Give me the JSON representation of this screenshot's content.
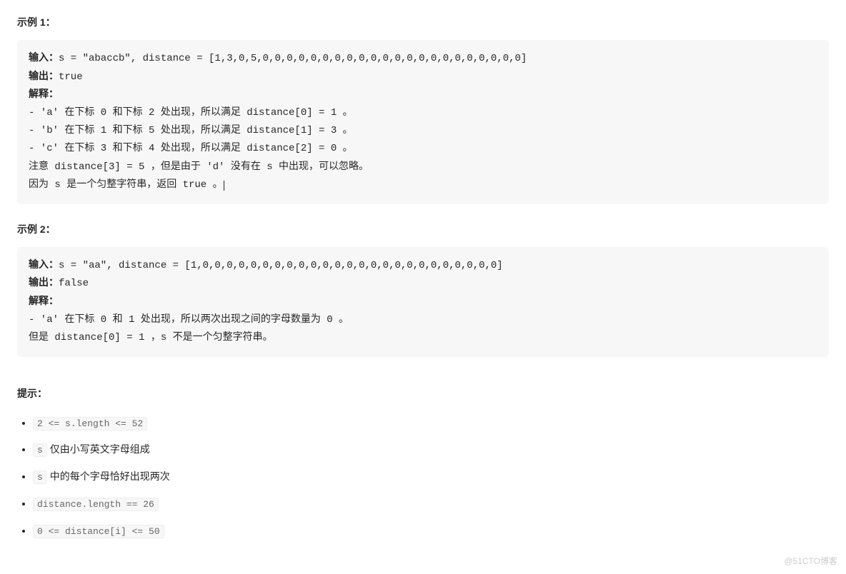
{
  "example1": {
    "title": "示例 1：",
    "input_label": "输入：",
    "input_value": "s = \"abaccb\", distance = [1,3,0,5,0,0,0,0,0,0,0,0,0,0,0,0,0,0,0,0,0,0,0,0,0,0]",
    "output_label": "输出：",
    "output_value": "true",
    "explain_label": "解释：",
    "lines": [
      "- 'a' 在下标 0 和下标 2 处出现，所以满足 distance[0] = 1 。",
      "- 'b' 在下标 1 和下标 5 处出现，所以满足 distance[1] = 3 。",
      "- 'c' 在下标 3 和下标 4 处出现，所以满足 distance[2] = 0 。",
      "注意 distance[3] = 5 ，但是由于 'd' 没有在 s 中出现，可以忽略。",
      "因为 s 是一个匀整字符串，返回 true 。"
    ]
  },
  "example2": {
    "title": "示例 2：",
    "input_label": "输入：",
    "input_value": "s = \"aa\", distance = [1,0,0,0,0,0,0,0,0,0,0,0,0,0,0,0,0,0,0,0,0,0,0,0,0,0]",
    "output_label": "输出：",
    "output_value": "false",
    "explain_label": "解释：",
    "lines": [
      "- 'a' 在下标 0 和 1 处出现，所以两次出现之间的字母数量为 0 。",
      "但是 distance[0] = 1 ，s 不是一个匀整字符串。"
    ]
  },
  "hints": {
    "title": "提示：",
    "items": [
      {
        "code": "2 <= s.length <= 52",
        "text": ""
      },
      {
        "code": "s",
        "text": " 仅由小写英文字母组成"
      },
      {
        "code": "s",
        "text": " 中的每个字母恰好出现两次"
      },
      {
        "code": "distance.length == 26",
        "text": ""
      },
      {
        "code": "0 <= distance[i] <= 50",
        "text": ""
      }
    ]
  },
  "watermark": "@51CTO博客"
}
